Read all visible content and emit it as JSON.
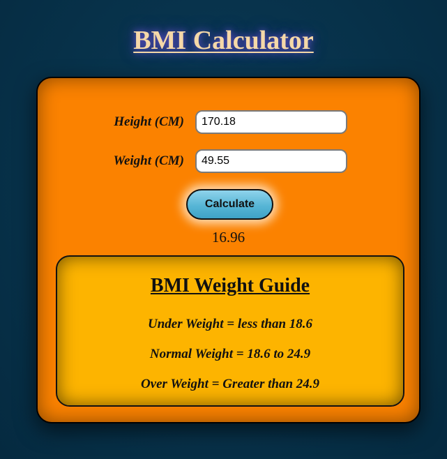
{
  "page": {
    "title": "BMI Calculator"
  },
  "form": {
    "height": {
      "label": "Height (CM)",
      "value": "170.18"
    },
    "weight": {
      "label": "Weight (CM)",
      "value": "49.55"
    },
    "calculate_label": "Calculate",
    "result": "16.96"
  },
  "guide": {
    "title": "BMI Weight Guide",
    "lines": [
      "Under Weight = less than 18.6",
      "Normal Weight = 18.6 to 24.9",
      "Over Weight = Greater than 24.9"
    ]
  },
  "colors": {
    "background": "#073149",
    "card": "#fb8200",
    "guide_panel": "#fdb400",
    "button": "#57b6d6",
    "title_text": "#f5d8a8"
  }
}
